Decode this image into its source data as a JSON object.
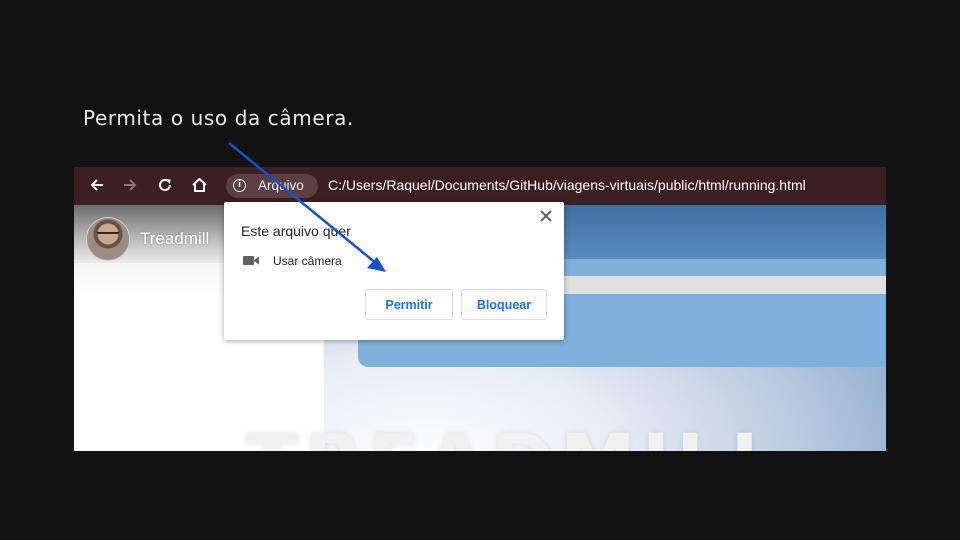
{
  "instruction": "Permita o uso da câmera.",
  "toolbar": {
    "back_icon": "arrow-left-icon",
    "forward_icon": "arrow-right-icon",
    "reload_icon": "reload-icon",
    "home_icon": "home-icon",
    "site_info_label": "Arquivo",
    "url": "C:/Users/Raquel/Documents/GitHub/viagens-virtuais/public/html/running.html"
  },
  "page": {
    "title": "Treadmill",
    "hero_text": "TREADMILL"
  },
  "dialog": {
    "heading": "Este arquivo quer",
    "permission_icon": "camera-icon",
    "permission": "Usar câmera",
    "allow_label": "Permitir",
    "block_label": "Bloquear",
    "close_icon": "close-icon"
  },
  "colors": {
    "background": "#121212",
    "toolbar": "#3c1f23",
    "button_text": "#1a73e8",
    "annotation_arrow": "#1453c8"
  }
}
